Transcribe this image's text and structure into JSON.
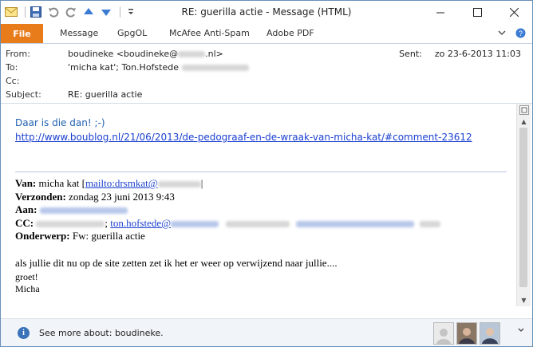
{
  "window": {
    "title": "RE: guerilla actie  -  Message (HTML)",
    "controls": [
      "minimize-icon",
      "maximize-icon",
      "close-icon"
    ]
  },
  "quick_access": [
    "mail-icon",
    "save-icon",
    "undo-icon",
    "redo-icon",
    "up-arrow-icon",
    "down-arrow-icon",
    "customize-icon"
  ],
  "ribbon": {
    "file": "File",
    "tabs": [
      "Message",
      "GpgOL",
      "McAfee Anti-Spam",
      "Adobe PDF"
    ]
  },
  "header": {
    "from_label": "From:",
    "from_value_prefix": "boudineke <boudineke@",
    "from_value_suffix": ".nl>",
    "to_label": "To:",
    "to_value": "'micha kat'; Ton.Hofstede",
    "cc_label": "Cc:",
    "subject_label": "Subject:",
    "subject_value": "RE: guerilla actie",
    "sent_label": "Sent:",
    "sent_value": "zo 23-6-2013 11:03"
  },
  "body": {
    "greeting": "Daar is die dan! ;-)",
    "link": "http://www.boublog.nl/21/06/2013/de-pedograaf-en-de-wraak-van-micha-kat/#comment-23612",
    "fw": {
      "van_label": "Van:",
      "van_value": "micha kat [",
      "van_link": "mailto:drsmkat@",
      "verzonden_label": "Verzonden:",
      "verzonden_value": "zondag 23 juni 2013 9:43",
      "aan_label": "Aan:",
      "cc_label": "CC:",
      "cc_link": "ton.hofstede@",
      "onderwerp_label": "Onderwerp:",
      "onderwerp_value": "Fw: guerilla actie"
    },
    "message_line1": "als jullie dit nu op de site zetten zet ik het er weer op verwijzend naar jullie....",
    "message_line2": "groet!",
    "message_line3": "Micha"
  },
  "people_pane": {
    "text": "See more about: boudineke."
  },
  "colors": {
    "file_tab": "#e87b1a",
    "link": "#1a3fd0",
    "greeting": "#1f5fb0"
  }
}
